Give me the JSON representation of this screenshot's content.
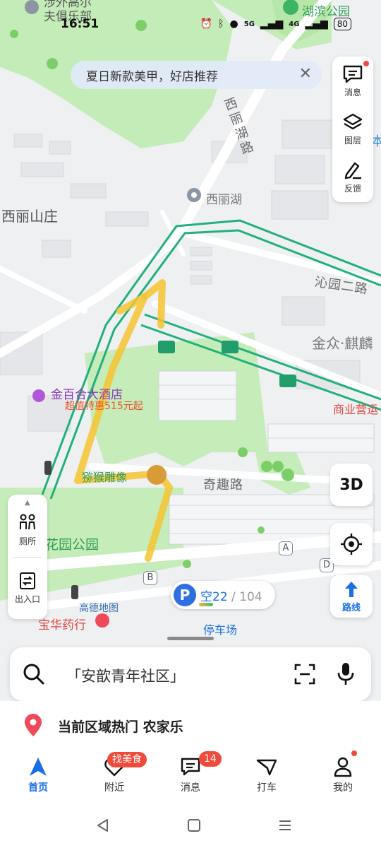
{
  "status_bar": {
    "time": "16:51",
    "signal_1": "5G",
    "signal_2": "4G",
    "battery": "80"
  },
  "banner": {
    "text": "夏日新款美甲，好店推荐",
    "close_glyph": "✕"
  },
  "tool_panel": {
    "messages_label": "消息",
    "layers_label": "图层",
    "feedback_label": "反馈"
  },
  "map_labels": {
    "poi_top_left": "涉外高尔\n夫俱乐部",
    "park_top_right": "湖滨公园",
    "xili_lake": "西丽湖",
    "xili_lake_road": "西丽湖路",
    "xili_mountain": "西丽山庄",
    "qinyuan_road": "沁园二路",
    "jinzhong": "金众·麒麟",
    "hotel": "金百合大酒店",
    "hotel_deal": "超值特惠515元起",
    "business": "商业营运",
    "monkey_statue": "猕猴雕像",
    "qiqu_road": "奇趣路",
    "garden_park": "花园公园",
    "amap_logo": "高德地图",
    "pharmacy": "宝华药行",
    "parking_lot": "停车场",
    "edge_char": "本",
    "marker_a": "A",
    "marker_b": "B",
    "marker_d": "D"
  },
  "left_panel": {
    "toilet_label": "厕所",
    "entrance_label": "出入口"
  },
  "controls": {
    "three_d": "3D",
    "route": "路线"
  },
  "parking": {
    "p": "P",
    "available": "空22",
    "total": " / 104",
    "occupancy_fraction": 0.79
  },
  "search": {
    "placeholder": "「安歆青年社区」"
  },
  "hot": {
    "text": "当前区域热门 农家乐"
  },
  "tabs": [
    {
      "label": "首页",
      "active": true
    },
    {
      "label": "附近",
      "badge": "找美食"
    },
    {
      "label": "消息",
      "badge": "14"
    },
    {
      "label": "打车"
    },
    {
      "label": "我的"
    }
  ],
  "colors": {
    "accent": "#1a6fe8",
    "route_green": "#22b07d",
    "park_green": "#bfe8b0",
    "badge_red": "#f04a3a",
    "highlight_yellow": "#f4c430"
  }
}
